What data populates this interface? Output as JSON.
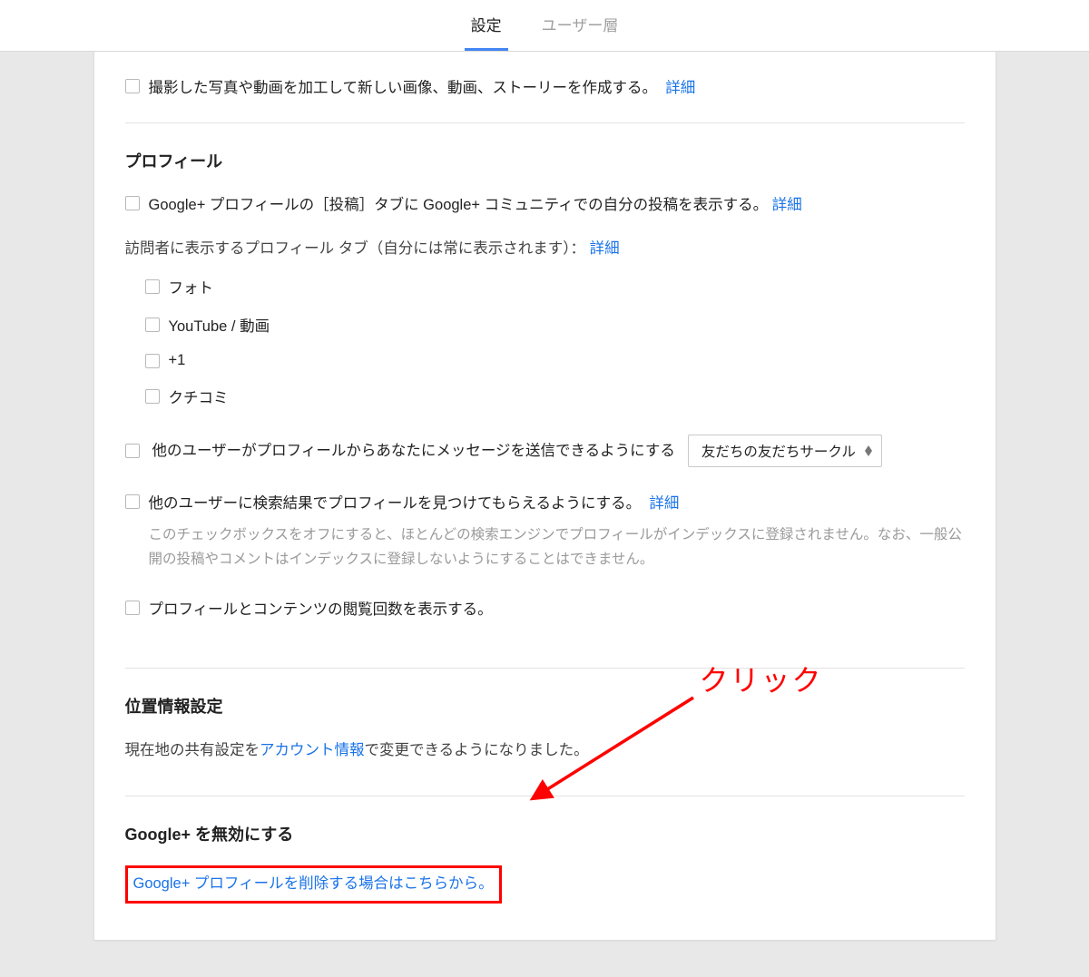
{
  "tabs": {
    "settings": "設定",
    "users": "ユーザー層"
  },
  "first_row": {
    "text": "撮影した写真や動画を加工して新しい画像、動画、ストーリーを作成する。",
    "more": "詳細"
  },
  "profile": {
    "title": "プロフィール",
    "show_posts_text": "Google+ プロフィールの［投稿］タブに Google+ コミュニティでの自分の投稿を表示する。",
    "show_posts_more": "詳細",
    "visitor_desc_pre": "訪問者に表示するプロフィール タブ（自分には常に表示されます）：",
    "visitor_more": "詳細",
    "tabs_list": {
      "photo": "フォト",
      "youtube": "YouTube / 動画",
      "plusone": "+1",
      "review": "クチコミ"
    },
    "allow_message_label": "他のユーザーがプロフィールからあなたにメッセージを送信できるようにする",
    "select_value": "友だちの友だちサークル",
    "searchable_label": "他のユーザーに検索結果でプロフィールを見つけてもらえるようにする。",
    "searchable_more": "詳細",
    "searchable_help": "このチェックボックスをオフにすると、ほとんどの検索エンジンでプロフィールがインデックスに登録されません。なお、一般公開の投稿やコメントはインデックスに登録しないようにすることはできません。",
    "view_count_label": "プロフィールとコンテンツの閲覧回数を表示する。"
  },
  "location": {
    "title": "位置情報設定",
    "desc_pre": "現在地の共有設定を",
    "desc_link": "アカウント情報",
    "desc_post": "で変更できるようになりました。"
  },
  "disable": {
    "title": "Google+ を無効にする",
    "link_text": "Google+ プロフィールを削除する場合はこちらから",
    "link_post": "。"
  },
  "annotation": {
    "label": "クリック"
  }
}
